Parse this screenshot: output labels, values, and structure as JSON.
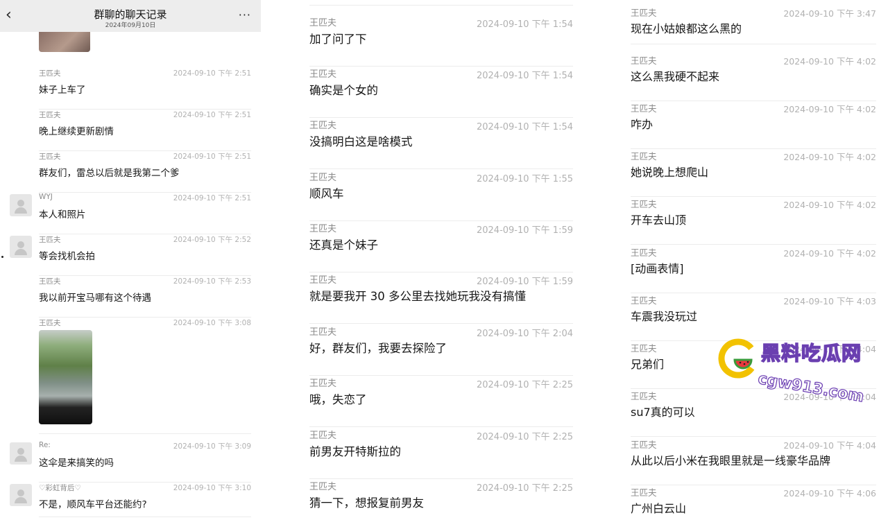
{
  "header": {
    "title": "群聊的聊天记录",
    "subtitle": "2024年09月10日",
    "back_icon": "‹",
    "more_icon": "···"
  },
  "col1": [
    {
      "name": "王匹夫",
      "time": "2024-09-10 下午 2:51",
      "text": "妹子上车了"
    },
    {
      "name": "王匹夫",
      "time": "2024-09-10 下午 2:51",
      "text": "晚上继续更新剧情"
    },
    {
      "name": "王匹夫",
      "time": "2024-09-10 下午 2:51",
      "text": "群友们，雷总以后就是我第二个爹"
    },
    {
      "name": "WYJ",
      "time": "2024-09-10 下午 2:51",
      "text": "本人和照片"
    },
    {
      "name": "王匹夫",
      "time": "2024-09-10 下午 2:52",
      "text": "等会找机会拍"
    },
    {
      "name": "王匹夫",
      "time": "2024-09-10 下午 2:53",
      "text": "我以前开宝马哪有这个待遇"
    },
    {
      "name": "王匹夫",
      "time": "2024-09-10 下午 3:08",
      "text": ""
    },
    {
      "name": "Re:",
      "time": "2024-09-10 下午 3:09",
      "text": "这伞是来搞笑的吗"
    },
    {
      "name": "♡彩虹背后♡",
      "time": "2024-09-10 下午 3:10",
      "text": "不是，顺风车平台还能约?"
    }
  ],
  "col2": [
    {
      "name": "王匹夫",
      "time": "2024-09-10 下午 1:54",
      "text": "加了问了下"
    },
    {
      "name": "王匹夫",
      "time": "2024-09-10 下午 1:54",
      "text": "确实是个女的"
    },
    {
      "name": "王匹夫",
      "time": "2024-09-10 下午 1:54",
      "text": "没搞明白这是啥模式"
    },
    {
      "name": "王匹夫",
      "time": "2024-09-10 下午 1:55",
      "text": "顺风车"
    },
    {
      "name": "王匹夫",
      "time": "2024-09-10 下午 1:59",
      "text": "还真是个妹子"
    },
    {
      "name": "王匹夫",
      "time": "2024-09-10 下午 1:59",
      "text": "就是要我开 30 多公里去找她玩我没有搞懂"
    },
    {
      "name": "王匹夫",
      "time": "2024-09-10 下午 2:04",
      "text": "好，群友们，我要去探险了"
    },
    {
      "name": "王匹夫",
      "time": "2024-09-10 下午 2:25",
      "text": "哦，失恋了"
    },
    {
      "name": "王匹夫",
      "time": "2024-09-10 下午 2:25",
      "text": "前男友开特斯拉的"
    },
    {
      "name": "王匹夫",
      "time": "2024-09-10 下午 2:25",
      "text": "猜一下，想报复前男友"
    }
  ],
  "col3": [
    {
      "name": "王匹夫",
      "time": "2024-09-10 下午 3:47",
      "text": "现在小姑娘都这么黑的"
    },
    {
      "name": "王匹夫",
      "time": "2024-09-10 下午 4:02",
      "text": "这么黑我硬不起来"
    },
    {
      "name": "王匹夫",
      "time": "2024-09-10 下午 4:02",
      "text": "咋办"
    },
    {
      "name": "王匹夫",
      "time": "2024-09-10 下午 4:02",
      "text": "她说晚上想爬山"
    },
    {
      "name": "王匹夫",
      "time": "2024-09-10 下午 4:02",
      "text": "开车去山顶"
    },
    {
      "name": "王匹夫",
      "time": "2024-09-10 下午 4:02",
      "text": "[动画表情]"
    },
    {
      "name": "王匹夫",
      "time": "2024-09-10 下午 4:03",
      "text": "车震我没玩过"
    },
    {
      "name": "王匹夫",
      "time": "2024-09-10 下午 4:04",
      "text": "兄弟们"
    },
    {
      "name": "王匹夫",
      "time": "2024-09-10 下午 4:04",
      "text": "su7真的可以"
    },
    {
      "name": "王匹夫",
      "time": "2024-09-10 下午 4:04",
      "text": "从此以后小米在我眼里就是一线豪华品牌"
    },
    {
      "name": "王匹夫",
      "time": "2024-09-10 下午 4:06",
      "text": "广州白云山"
    }
  ],
  "watermark": {
    "title": "黑料吃瓜网",
    "url": "cgw913.com"
  }
}
